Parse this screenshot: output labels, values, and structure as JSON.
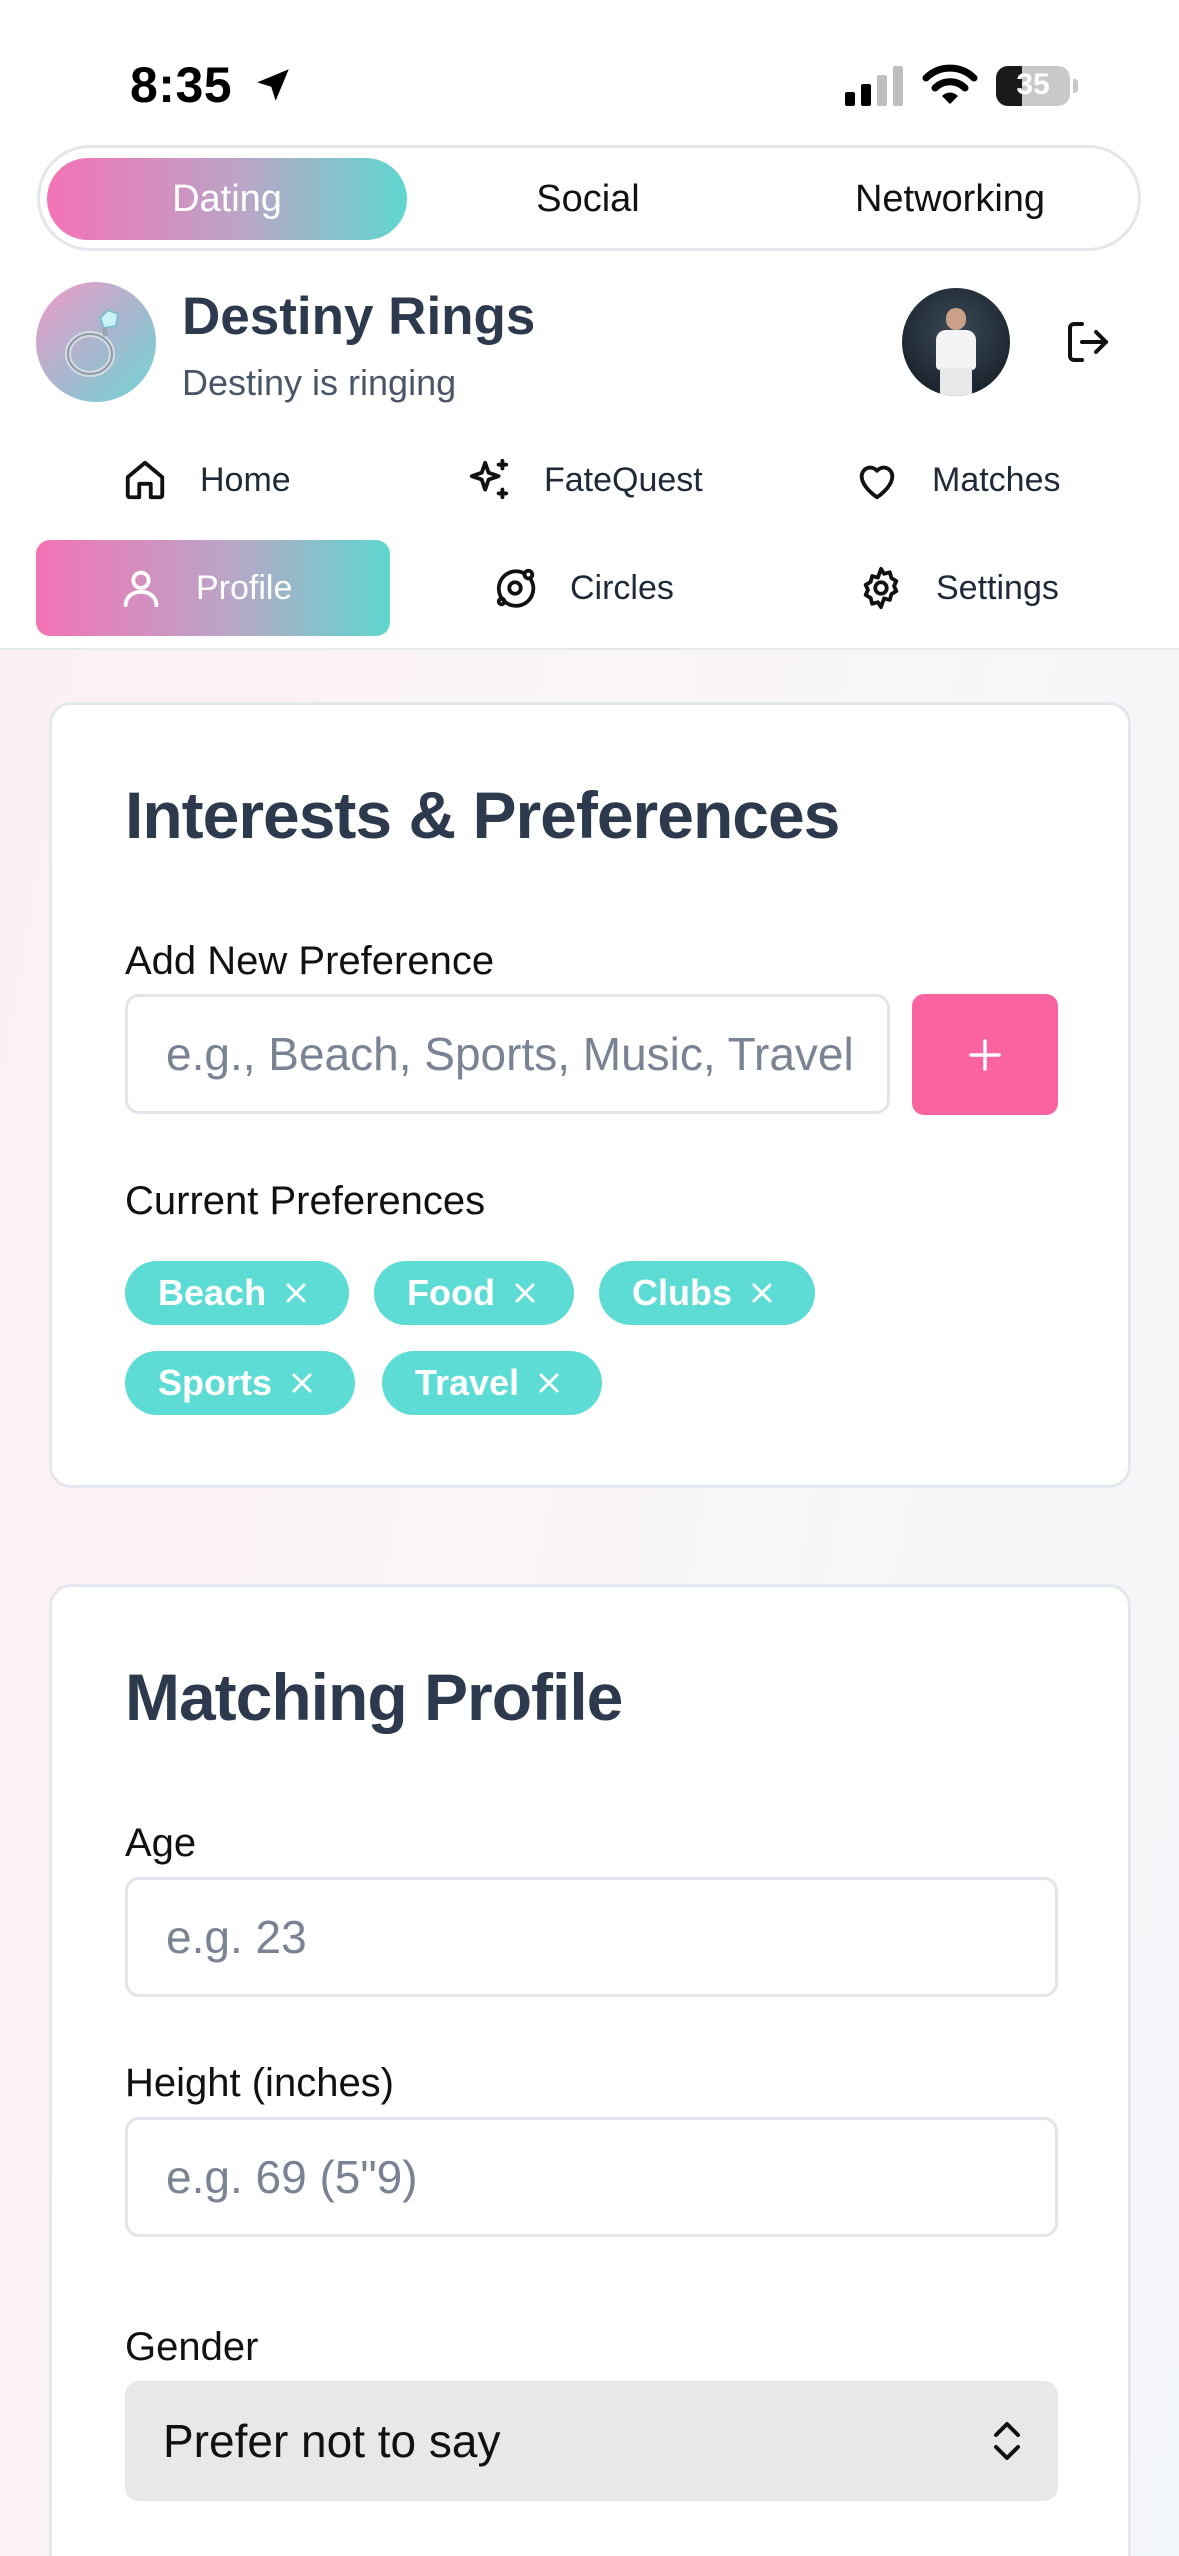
{
  "status_bar": {
    "time": "8:35",
    "battery": "35",
    "battery_level": 0.35
  },
  "mode_switch": {
    "tabs": [
      "Dating",
      "Social",
      "Networking"
    ],
    "active": "Dating"
  },
  "header": {
    "title": "Destiny Rings",
    "subtitle": "Destiny is ringing"
  },
  "nav": {
    "items": [
      {
        "label": "Home",
        "icon": "home-icon"
      },
      {
        "label": "FateQuest",
        "icon": "sparkles-icon"
      },
      {
        "label": "Matches",
        "icon": "heart-icon"
      },
      {
        "label": "Profile",
        "icon": "user-icon",
        "active": true
      },
      {
        "label": "Circles",
        "icon": "orbit-icon"
      },
      {
        "label": "Settings",
        "icon": "gear-icon"
      }
    ]
  },
  "interests": {
    "title": "Interests & Preferences",
    "add_label": "Add New Preference",
    "add_placeholder": "e.g., Beach, Sports, Music, Travel",
    "add_button": "+",
    "current_label": "Current Preferences",
    "chips": [
      "Beach",
      "Food",
      "Clubs",
      "Sports",
      "Travel"
    ]
  },
  "matching": {
    "title": "Matching Profile",
    "age_label": "Age",
    "age_placeholder": "e.g. 23",
    "height_label": "Height (inches)",
    "height_placeholder": "e.g. 69 (5\"9)",
    "gender_label": "Gender",
    "gender_value": "Prefer not to say"
  },
  "colors": {
    "accent_pink": "#fb63a0",
    "chip_teal": "#5ddcd5",
    "heading": "#2d3a4e"
  }
}
